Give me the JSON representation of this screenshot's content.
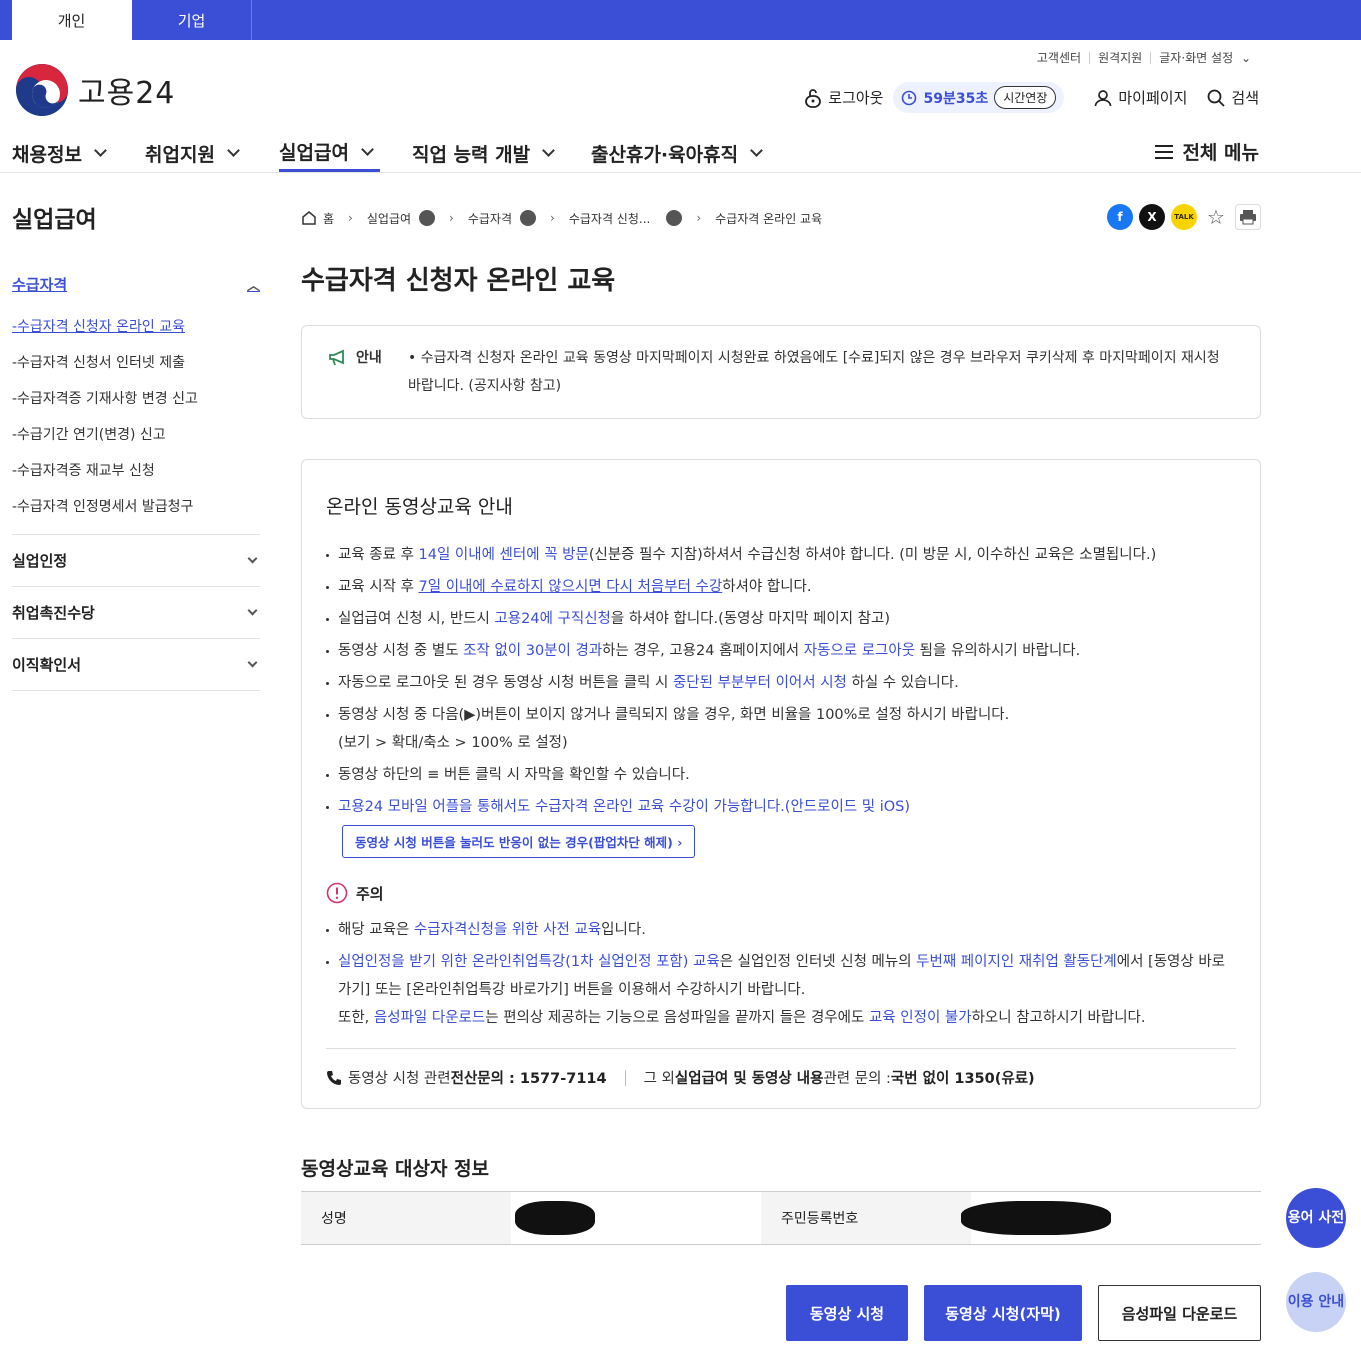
{
  "top_tabs": [
    "개인",
    "기업"
  ],
  "util_links": [
    "고객센터",
    "원격지원",
    "글자·화면 설정"
  ],
  "logo_text": "고용24",
  "header": {
    "logout": "로그아웃",
    "timer": "59분35초",
    "extend": "시간연장",
    "mypage": "마이페이지",
    "search": "검색"
  },
  "gnb": [
    "채용정보",
    "취업지원",
    "실업급여",
    "직업 능력 개발",
    "출산휴가·육아휴직"
  ],
  "all_menu": "전체 메뉴",
  "sidebar": {
    "title": "실업급여",
    "open_section": "수급자격",
    "sub_items": [
      "-수급자격 신청자 온라인 교육",
      "-수급자격 신청서 인터넷 제출",
      "-수급자격증 기재사항 변경 신고",
      "-수급기간 연기(변경) 신고",
      "-수급자격증 재교부 신청",
      "-수급자격 인정명세서 발급청구"
    ],
    "sections": [
      "실업인정",
      "취업촉진수당",
      "이직확인서"
    ]
  },
  "breadcrumb": [
    "홈",
    "실업급여",
    "수급자격",
    "수급자격 신청...",
    "수급자격 온라인 교육"
  ],
  "share_icons": [
    "f",
    "X",
    "TALK"
  ],
  "page_title": "수급자격 신청자 온라인 교육",
  "notice": {
    "label": "안내",
    "text": "• 수급자격 신청자 온라인 교육 동영상 마지막페이지 시청완료 하였음에도 [수료]되지 않은 경우 브라우저 쿠키삭제 후 마지막페이지 재시청 바랍니다. (공지사항 참고)"
  },
  "guide": {
    "title": "온라인 동영상교육 안내",
    "b1": [
      "교육 종료 후 ",
      "14일 이내에 센터에 꼭 방문",
      "(신분증 필수 지참)하셔서 수급신청 하셔야 합니다. (미 방문 시, 이수하신 교육은 소멸됩니다.)"
    ],
    "b2": [
      "교육 시작 후 ",
      "7일 이내에 수료하지 않으시면 다시 처음부터 수강",
      "하셔야 합니다."
    ],
    "b3": [
      "실업급여 신청 시, 반드시 ",
      "고용24에 구직신청",
      "을 하셔야 합니다.(동영상 마지막 페이지 참고)"
    ],
    "b4": [
      "동영상 시청 중 별도 ",
      "조작 없이 30분이 경과",
      "하는 경우, 고용24 홈페이지에서 ",
      "자동으로 로그아웃",
      " 됨을 유의하시기 바랍니다."
    ],
    "b5": [
      "자동으로 로그아웃 된 경우 동영상 시청 버튼을 클릭 시 ",
      "중단된 부분부터 이어서 시청",
      " 하실 수 있습니다."
    ],
    "b6": [
      "동영상 시청 중 다음(▶)버튼이 보이지 않거나 클릭되지 않을 경우, 화면 비율을 100%로 설정 하시기 바랍니다.",
      "(보기 > 확대/축소 > 100% 로 설정)"
    ],
    "b7": "동영상 하단의 ≡ 버튼 클릭 시 자막을 확인할 수 있습니다.",
    "b8": "고용24 모바일 어플을 통해서도 수급자격 온라인 교육 수강이 가능합니다.(안드로이드 및 iOS)",
    "popup_btn": "동영상 시청 버튼을 눌러도 반응이 없는 경우(팝업차단 해제)"
  },
  "caution": {
    "label": "주의",
    "c1": [
      "해당 교육은 ",
      "수급자격신청을 위한 사전 교육",
      "입니다."
    ],
    "c2": [
      "실업인정을 받기 위한 온라인취업특강(1차 실업인정 포함) 교육",
      "은 실업인정 인터넷 신청 메뉴의 ",
      "두번째 페이지인 재취업 활동단계",
      "에서 [동영상 바로가기] 또는 [온라인취업특강 바로가기] 버튼을 이용해서 수강하시기 바랍니다."
    ],
    "c3": [
      "또한, ",
      "음성파일 다운로드",
      "는 편의상 제공하는 기능으로 음성파일을 끝까지 들은 경우에도 ",
      "교육 인정이 불가",
      "하오니 참고하시기 바랍니다."
    ]
  },
  "contact": {
    "p1": "동영상 시청 관련 ",
    "p1b": "전산문의 : 1577-7114",
    "p2": "그 외 ",
    "p2b": "실업급여 및 동영상 내용",
    "p2c": " 관련 문의 : ",
    "p2d": "국번 없이 1350(유료)"
  },
  "target": {
    "title": "동영상교육 대상자 정보",
    "name_label": "성명",
    "rrn_label": "주민등록번호"
  },
  "buttons": [
    "동영상 시청",
    "동영상 시청(자막)",
    "음성파일 다운로드"
  ],
  "floating": [
    "용어 사전",
    "이용 안내"
  ]
}
